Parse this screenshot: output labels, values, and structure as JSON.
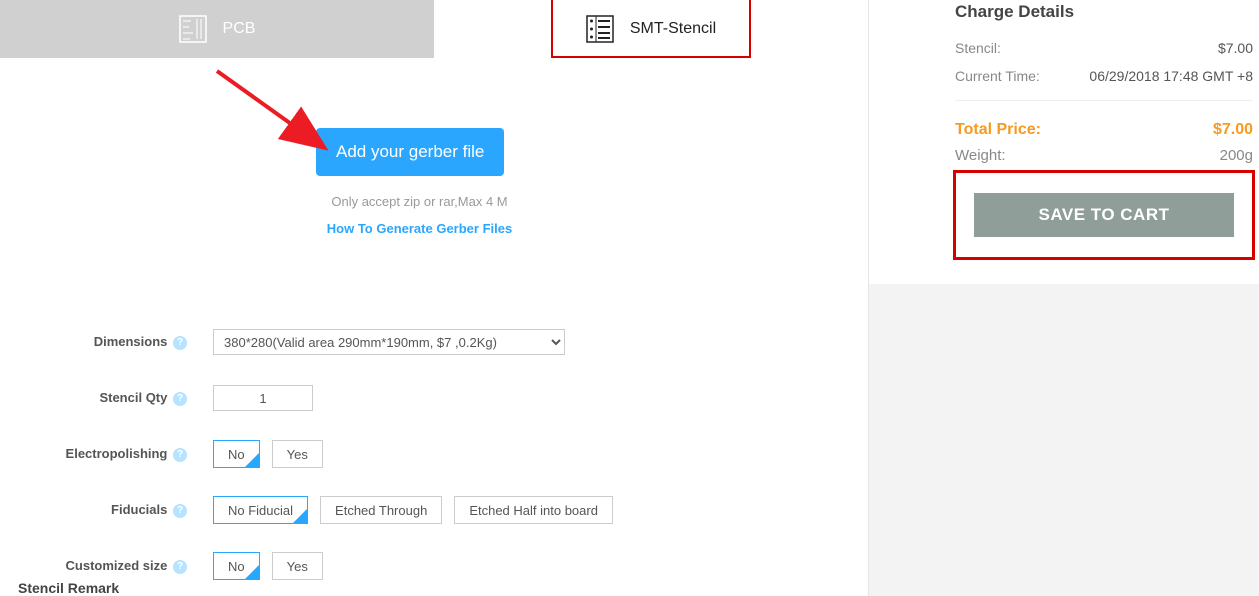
{
  "tabs": {
    "pcb": "PCB",
    "smt": "SMT-Stencil"
  },
  "upload": {
    "button": "Add your gerber file",
    "hint": "Only accept zip or rar,Max 4 M",
    "link": "How To Generate Gerber Files"
  },
  "form": {
    "dimensions": {
      "label": "Dimensions",
      "value": "380*280(Valid area 290mm*190mm, $7 ,0.2Kg)"
    },
    "qty": {
      "label": "Stencil Qty",
      "value": "1"
    },
    "electro": {
      "label": "Electropolishing",
      "no": "No",
      "yes": "Yes"
    },
    "fiducials": {
      "label": "Fiducials",
      "opt1": "No Fiducial",
      "opt2": "Etched Through",
      "opt3": "Etched Half into board"
    },
    "custom": {
      "label": "Customized size",
      "no": "No",
      "yes": "Yes"
    },
    "remark": "Stencil Remark"
  },
  "charge": {
    "title": "Charge Details",
    "stencil_label": "Stencil:",
    "stencil_value": "$7.00",
    "time_label": "Current Time:",
    "time_value": "06/29/2018 17:48 GMT +8",
    "total_label": "Total Price:",
    "total_value": "$7.00",
    "weight_label": "Weight:",
    "weight_value": "200g",
    "save": "SAVE TO CART"
  }
}
